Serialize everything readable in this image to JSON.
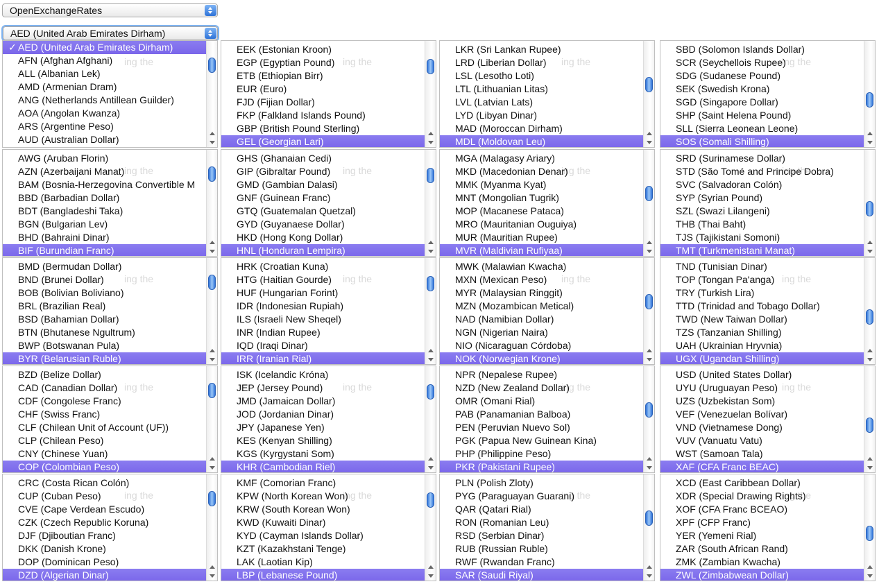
{
  "provider_select": {
    "value": "OpenExchangeRates"
  },
  "currency_select": {
    "value": "AED (United Arab Emirates Dirham)"
  },
  "background_ghost": "ing the",
  "lists": [
    {
      "items": [
        "AED (United Arab Emirates Dirham)",
        "AFN (Afghan Afghani)",
        "ALL (Albanian Lek)",
        "AMD (Armenian Dram)",
        "ANG (Netherlands Antillean Guilder)",
        "AOA (Angolan Kwanza)",
        "ARS (Argentine Peso)",
        "AUD (Australian Dollar)"
      ],
      "selected": 0,
      "check": true
    },
    {
      "items": [
        "EEK (Estonian Kroon)",
        "EGP (Egyptian Pound)",
        "ETB (Ethiopian Birr)",
        "EUR (Euro)",
        "FJD (Fijian Dollar)",
        "FKP (Falkland Islands Pound)",
        "GBP (British Pound Sterling)",
        "GEL (Georgian Lari)"
      ],
      "selected": 7
    },
    {
      "items": [
        "LKR (Sri Lankan Rupee)",
        "LRD (Liberian Dollar)",
        "LSL (Lesotho Loti)",
        "LTL (Lithuanian Litas)",
        "LVL (Latvian Lats)",
        "LYD (Libyan Dinar)",
        "MAD (Moroccan Dirham)",
        "MDL (Moldovan Leu)"
      ],
      "selected": 7
    },
    {
      "items": [
        "SBD (Solomon Islands Dollar)",
        "SCR (Seychellois Rupee)",
        "SDG (Sudanese Pound)",
        "SEK (Swedish Krona)",
        "SGD (Singapore Dollar)",
        "SHP (Saint Helena Pound)",
        "SLL (Sierra Leonean Leone)",
        "SOS (Somali Shilling)"
      ],
      "selected": 7
    },
    {
      "items": [
        "AWG (Aruban Florin)",
        "AZN (Azerbaijani Manat)",
        "BAM (Bosnia-Herzegovina Convertible M",
        "BBD (Barbadian Dollar)",
        "BDT (Bangladeshi Taka)",
        "BGN (Bulgarian Lev)",
        "BHD (Bahraini Dinar)",
        "BIF (Burundian Franc)"
      ],
      "selected": 7
    },
    {
      "items": [
        "GHS (Ghanaian Cedi)",
        "GIP (Gibraltar Pound)",
        "GMD (Gambian Dalasi)",
        "GNF (Guinean Franc)",
        "GTQ (Guatemalan Quetzal)",
        "GYD (Guyanaese Dollar)",
        "HKD (Hong Kong Dollar)",
        "HNL (Honduran Lempira)"
      ],
      "selected": 7
    },
    {
      "items": [
        "MGA (Malagasy Ariary)",
        "MKD (Macedonian Denar)",
        "MMK (Myanma Kyat)",
        "MNT (Mongolian Tugrik)",
        "MOP (Macanese Pataca)",
        "MRO (Mauritanian Ouguiya)",
        "MUR (Mauritian Rupee)",
        "MVR (Maldivian Rufiyaa)"
      ],
      "selected": 7
    },
    {
      "items": [
        "SRD (Surinamese Dollar)",
        "STD (São Tomé and Principe Dobra)",
        "SVC (Salvadoran Colón)",
        "SYP (Syrian Pound)",
        "SZL (Swazi Lilangeni)",
        "THB (Thai Baht)",
        "TJS (Tajikistani Somoni)",
        "TMT (Turkmenistani Manat)"
      ],
      "selected": 7
    },
    {
      "items": [
        "BMD (Bermudan Dollar)",
        "BND (Brunei Dollar)",
        "BOB (Bolivian Boliviano)",
        "BRL (Brazilian Real)",
        "BSD (Bahamian Dollar)",
        "BTN (Bhutanese Ngultrum)",
        "BWP (Botswanan Pula)",
        "BYR (Belarusian Ruble)"
      ],
      "selected": 7
    },
    {
      "items": [
        "HRK (Croatian Kuna)",
        "HTG (Haitian Gourde)",
        "HUF (Hungarian Forint)",
        "IDR (Indonesian Rupiah)",
        "ILS (Israeli New Sheqel)",
        "INR (Indian Rupee)",
        "IQD (Iraqi Dinar)",
        "IRR (Iranian Rial)"
      ],
      "selected": 7
    },
    {
      "items": [
        "MWK (Malawian Kwacha)",
        "MXN (Mexican Peso)",
        "MYR (Malaysian Ringgit)",
        "MZN (Mozambican Metical)",
        "NAD (Namibian Dollar)",
        "NGN (Nigerian Naira)",
        "NIO (Nicaraguan Córdoba)",
        "NOK (Norwegian Krone)"
      ],
      "selected": 7
    },
    {
      "items": [
        "TND (Tunisian Dinar)",
        "TOP (Tongan Pa'anga)",
        "TRY (Turkish Lira)",
        "TTD (Trinidad and Tobago Dollar)",
        "TWD (New Taiwan Dollar)",
        "TZS (Tanzanian Shilling)",
        "UAH (Ukrainian Hryvnia)",
        "UGX (Ugandan Shilling)"
      ],
      "selected": 7
    },
    {
      "items": [
        "BZD (Belize Dollar)",
        "CAD (Canadian Dollar)",
        "CDF (Congolese Franc)",
        "CHF (Swiss Franc)",
        "CLF (Chilean Unit of Account (UF))",
        "CLP (Chilean Peso)",
        "CNY (Chinese Yuan)",
        "COP (Colombian Peso)"
      ],
      "selected": 7
    },
    {
      "items": [
        "ISK (Icelandic Króna)",
        "JEP (Jersey Pound)",
        "JMD (Jamaican Dollar)",
        "JOD (Jordanian Dinar)",
        "JPY (Japanese Yen)",
        "KES (Kenyan Shilling)",
        "KGS (Kyrgystani Som)",
        "KHR (Cambodian Riel)"
      ],
      "selected": 7
    },
    {
      "items": [
        "NPR (Nepalese Rupee)",
        "NZD (New Zealand Dollar)",
        "OMR (Omani Rial)",
        "PAB (Panamanian Balboa)",
        "PEN (Peruvian Nuevo Sol)",
        "PGK (Papua New Guinean Kina)",
        "PHP (Philippine Peso)",
        "PKR (Pakistani Rupee)"
      ],
      "selected": 7
    },
    {
      "items": [
        "USD (United States Dollar)",
        "UYU (Uruguayan Peso)",
        "UZS (Uzbekistan Som)",
        "VEF (Venezuelan Bolívar)",
        "VND (Vietnamese Dong)",
        "VUV (Vanuatu Vatu)",
        "WST (Samoan Tala)",
        "XAF (CFA Franc BEAC)"
      ],
      "selected": 7
    },
    {
      "items": [
        "CRC (Costa Rican Colón)",
        "CUP (Cuban Peso)",
        "CVE (Cape Verdean Escudo)",
        "CZK (Czech Republic Koruna)",
        "DJF (Djiboutian Franc)",
        "DKK (Danish Krone)",
        "DOP (Dominican Peso)",
        "DZD (Algerian Dinar)"
      ],
      "selected": 7
    },
    {
      "items": [
        "KMF (Comorian Franc)",
        "KPW (North Korean Won)",
        "KRW (South Korean Won)",
        "KWD (Kuwaiti Dinar)",
        "KYD (Cayman Islands Dollar)",
        "KZT (Kazakhstani Tenge)",
        "LAK (Laotian Kip)",
        "LBP (Lebanese Pound)"
      ],
      "selected": 7
    },
    {
      "items": [
        "PLN (Polish Zloty)",
        "PYG (Paraguayan Guarani)",
        "QAR (Qatari Rial)",
        "RON (Romanian Leu)",
        "RSD (Serbian Dinar)",
        "RUB (Russian Ruble)",
        "RWF (Rwandan Franc)",
        "SAR (Saudi Riyal)"
      ],
      "selected": 7
    },
    {
      "items": [
        "XCD (East Caribbean Dollar)",
        "XDR (Special Drawing Rights)",
        "XOF (CFA Franc BCEAO)",
        "XPF (CFP Franc)",
        "YER (Yemeni Rial)",
        "ZAR (South African Rand)",
        "ZMK (Zambian Kwacha)",
        "ZWL (Zimbabwean Dollar)"
      ],
      "selected": 7
    }
  ]
}
